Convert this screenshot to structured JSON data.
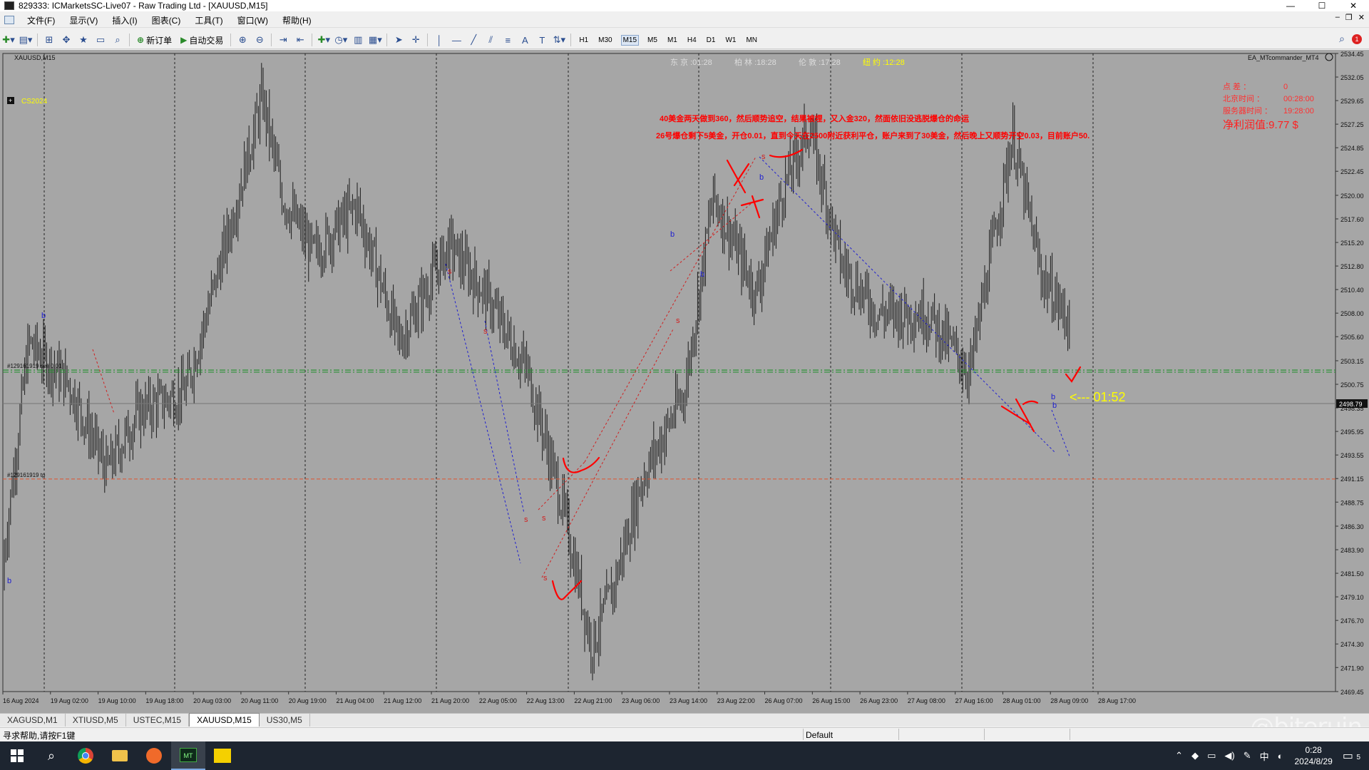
{
  "window": {
    "title": "829333: ICMarketsSC-Live07 - Raw Trading Ltd - [XAUUSD,M15]",
    "minimize": "—",
    "maximize": "☐",
    "close": "✕"
  },
  "menu": [
    "文件(F)",
    "显示(V)",
    "插入(I)",
    "图表(C)",
    "工具(T)",
    "窗口(W)",
    "帮助(H)"
  ],
  "toolbar": {
    "new_order": "新订单",
    "auto_trading": "自动交易",
    "timeframes": [
      "H1",
      "M30",
      "M15",
      "M5",
      "M1",
      "H4",
      "D1",
      "W1",
      "MN"
    ],
    "active_timeframe": "M15",
    "alert_count": "1"
  },
  "chart": {
    "symbol_label": "XAUUSD,M15",
    "indicator_label": "CS2024",
    "ea_label": "EA_MTcommander_MT4",
    "sessions": [
      {
        "label": "东 京 :01:28",
        "color": "#dcdcdc"
      },
      {
        "label": "柏 林 :18:28",
        "color": "#dcdcdc"
      },
      {
        "label": "伦 敦 :17:28",
        "color": "#dcdcdc"
      },
      {
        "label": "纽 约 :12:28",
        "color": "#ffff00"
      }
    ],
    "info_panel": [
      {
        "label": "点 差 ：",
        "value": "0"
      },
      {
        "label": "北京时间 ：",
        "value": "00:28:00"
      },
      {
        "label": "服务器时间 ：",
        "value": "19:28:00"
      }
    ],
    "net_profit": "净利润值:9.77 $",
    "annotation_line1": "40美金两天做到360，然后顺势追空，结果被埋，又入金320，然面依旧没逃脱爆仓的命运",
    "annotation_line2": "26号爆仓剩下5美金，开仓0.01，直到今天在2500附近获利平仓，账户来到了30美金，然后晚上又顺势开空0.03，目前账户50.",
    "countdown": "<--- 01:52",
    "order_label_1": "#129161919 sell 0.01",
    "order_label_2": "#129161919 tp",
    "current_price": "2498.79",
    "price_labels": [
      "2534.45",
      "2532.05",
      "2529.65",
      "2527.25",
      "2524.85",
      "2522.45",
      "2520.00",
      "2517.60",
      "2515.20",
      "2512.80",
      "2510.40",
      "2508.00",
      "2505.60",
      "2503.15",
      "2500.75",
      "2498.35",
      "2495.95",
      "2493.55",
      "2491.15",
      "2488.75",
      "2486.30",
      "2483.90",
      "2481.50",
      "2479.10",
      "2476.70",
      "2474.30",
      "2471.90",
      "2469.45"
    ],
    "time_labels": [
      "16 Aug 2024",
      "19 Aug 02:00",
      "19 Aug 10:00",
      "19 Aug 18:00",
      "20 Aug 03:00",
      "20 Aug 11:00",
      "20 Aug 19:00",
      "21 Aug 04:00",
      "21 Aug 12:00",
      "21 Aug 20:00",
      "22 Aug 05:00",
      "22 Aug 13:00",
      "22 Aug 21:00",
      "23 Aug 06:00",
      "23 Aug 14:00",
      "23 Aug 22:00",
      "26 Aug 07:00",
      "26 Aug 15:00",
      "26 Aug 23:00",
      "27 Aug 08:00",
      "27 Aug 16:00",
      "28 Aug 01:00",
      "28 Aug 09:00",
      "28 Aug 17:00"
    ],
    "trade_letters": [
      "b",
      "b",
      "s",
      "s",
      "s",
      "s",
      "b",
      "s",
      "s",
      "b",
      "b",
      "s",
      "b",
      "b"
    ],
    "colors": {
      "background": "#a6a6a6",
      "bars": "#1a1a1a",
      "green_line": "#1f8f2a",
      "tp_line": "#e0522c",
      "annotation": "#ff0000",
      "trade_blue": "#2020d0",
      "trade_red": "#d02020",
      "countdown": "#ffff00"
    }
  },
  "tabs": [
    "XAGUSD,M1",
    "XTIUSD,M5",
    "USTEC,M15",
    "XAUUSD,M15",
    "US30,M5"
  ],
  "active_tab": "XAUUSD,M15",
  "status": {
    "help": "寻求帮助,请按F1键",
    "profile": "Default"
  },
  "watermark": "@biteruin",
  "taskbar": {
    "tray_lang": "中",
    "clock_time": "0:28",
    "clock_date": "2024/8/29",
    "notifications": "5"
  }
}
